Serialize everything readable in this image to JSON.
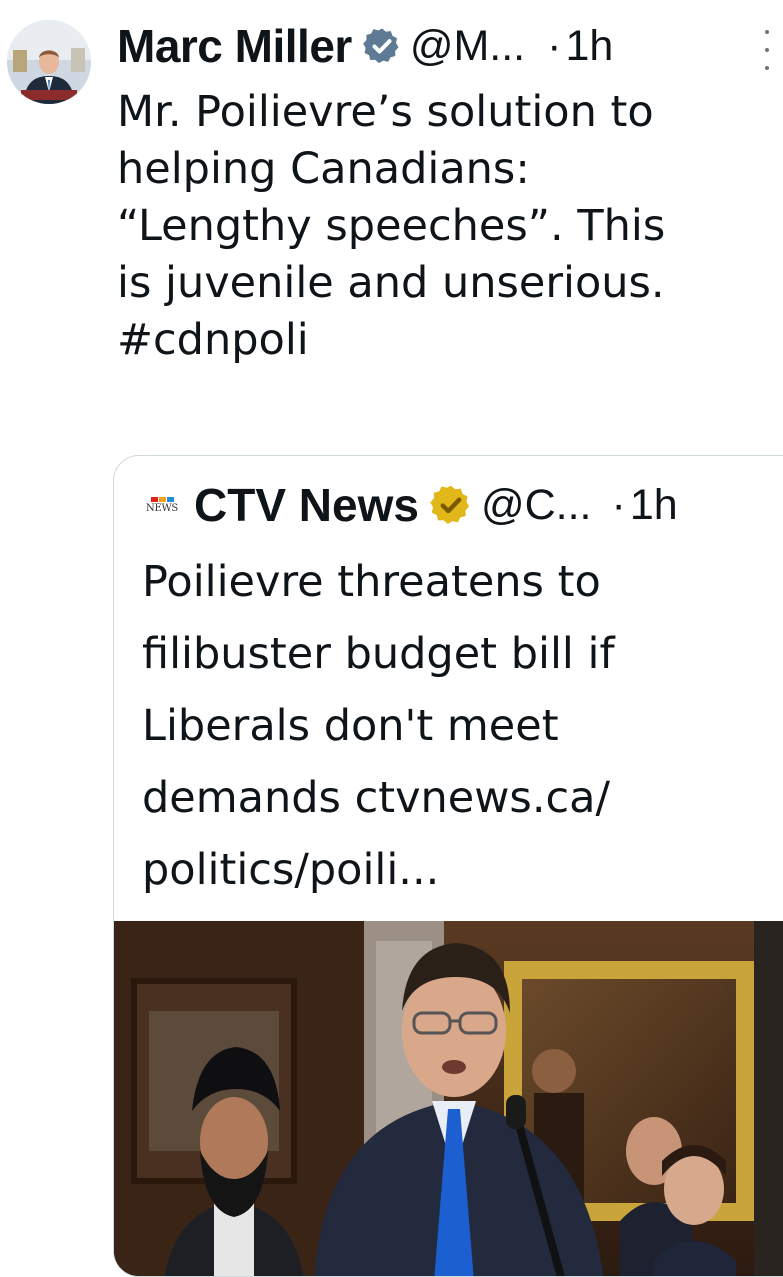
{
  "tweet": {
    "author_name": "Marc Miller",
    "handle": "@M...",
    "separator": "·",
    "time": "1h",
    "text_lines": [
      "Mr. Poilievre’s solution to",
      "helping Canadians:",
      "“Lengthy speeches”. This",
      "is juvenile and unserious.",
      "#cdnpoli"
    ],
    "verified_badge": "blue-verified-badge-icon",
    "more_menu": "more-options-icon"
  },
  "quoted_tweet": {
    "author_name": "CTV News",
    "logo_text": "NEWS",
    "handle": "@C...",
    "separator": "·",
    "time": "1h",
    "verified_badge": "gold-verified-badge-icon",
    "text_lines": [
      "Poilievre threatens to",
      "filibuster budget bill if",
      "Liberals don't meet",
      "demands ctvnews.ca/",
      "politics/poili..."
    ]
  },
  "colors": {
    "text": "#0f1419",
    "border": "#cfd9de",
    "blue_badge": "#5e7a94",
    "gold_badge": "#e2b719"
  }
}
